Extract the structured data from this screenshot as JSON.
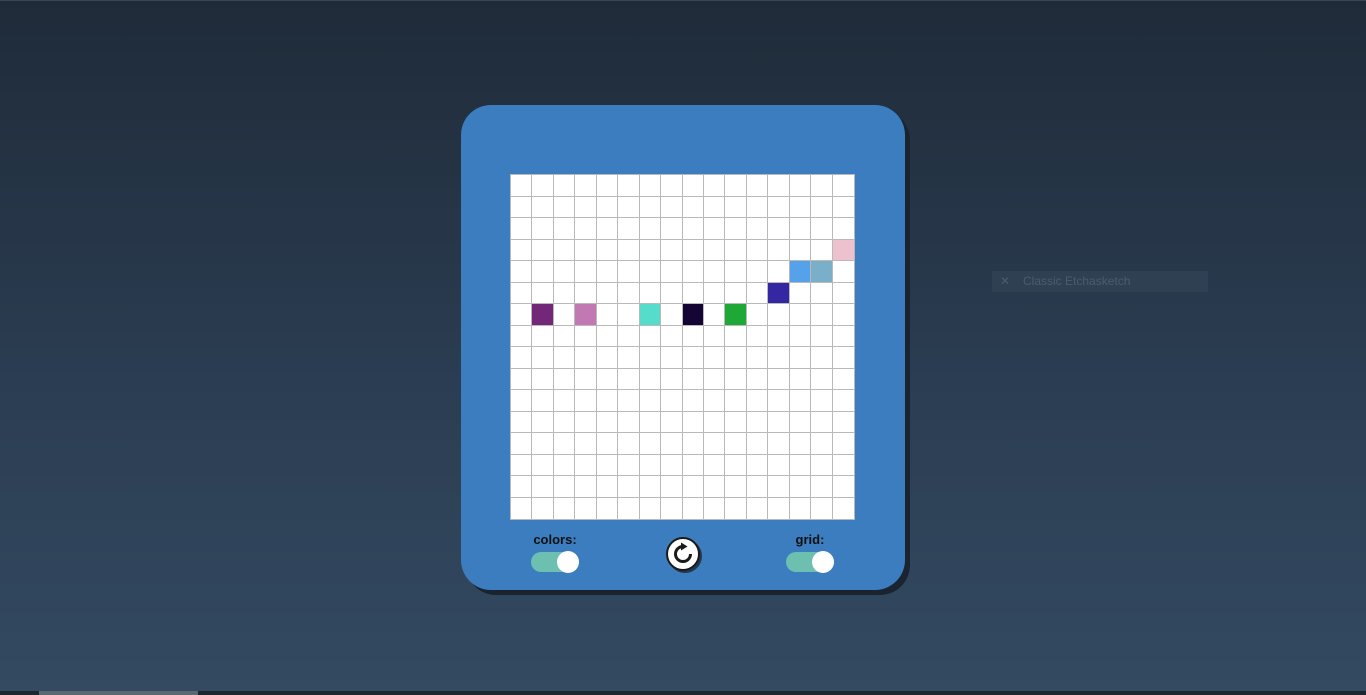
{
  "controls": {
    "colors_label": "colors:",
    "grid_label": "grid:",
    "colors_enabled": true,
    "grid_enabled": true,
    "reset_icon": "refresh-icon"
  },
  "grid": {
    "columns": 16,
    "rows": 16,
    "filled_cells": [
      {
        "row": 3,
        "col": 15,
        "color": "#eec1cf"
      },
      {
        "row": 4,
        "col": 13,
        "color": "#55a1ea"
      },
      {
        "row": 4,
        "col": 14,
        "color": "#7aafca"
      },
      {
        "row": 5,
        "col": 12,
        "color": "#3527a1"
      },
      {
        "row": 6,
        "col": 1,
        "color": "#732778"
      },
      {
        "row": 6,
        "col": 3,
        "color": "#c278b2"
      },
      {
        "row": 6,
        "col": 6,
        "color": "#55dcca"
      },
      {
        "row": 6,
        "col": 8,
        "color": "#150535"
      },
      {
        "row": 6,
        "col": 10,
        "color": "#1ea936"
      }
    ]
  },
  "overlay": {
    "tip_text": "Classic Etchasketch",
    "tip_icon": "close-icon"
  },
  "colors": {
    "device": "#3b7dbf",
    "toggle_on": "#6dbfb0",
    "grid_line": "#b9b9b9"
  }
}
